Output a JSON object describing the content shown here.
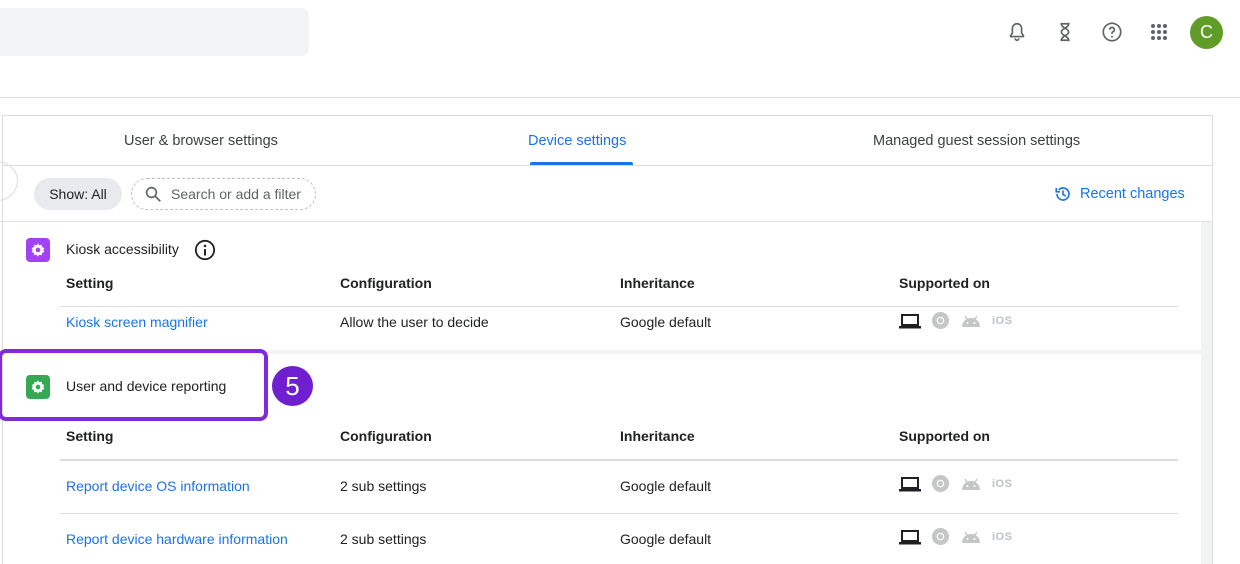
{
  "top_bar": {
    "icons": [
      "bell-icon",
      "hourglass-icon",
      "help-icon",
      "apps-grid-icon"
    ],
    "avatar_initial": "C",
    "avatar_color": "#5f9c28"
  },
  "tabs": [
    {
      "label": "User & browser settings",
      "active": false
    },
    {
      "label": "Device settings",
      "active": true
    },
    {
      "label": "Managed guest session settings",
      "active": false
    }
  ],
  "filter_bar": {
    "show_label": "Show: All",
    "search_placeholder": "Search or add a filter",
    "recent_changes_label": "Recent changes"
  },
  "columns": [
    "Setting",
    "Configuration",
    "Inheritance",
    "Supported on"
  ],
  "sections": [
    {
      "title": "Kiosk accessibility",
      "icon": "settings-gear-icon",
      "icon_color": "#a142f4",
      "has_info_icon": true,
      "rows": [
        {
          "setting": "Kiosk screen magnifier",
          "configuration": "Allow the user to decide",
          "inheritance": "Google default"
        }
      ]
    },
    {
      "title": "User and device reporting",
      "icon": "settings-gear-icon",
      "icon_color": "#34a853",
      "has_info_icon": false,
      "rows": [
        {
          "setting": "Report device OS information",
          "configuration": "2 sub settings",
          "inheritance": "Google default"
        },
        {
          "setting": "Report device hardware information",
          "configuration": "2 sub settings",
          "inheritance": "Google default"
        }
      ]
    }
  ],
  "supported_platforms": [
    "laptop-icon",
    "chrome-icon",
    "android-icon",
    "ios-icon"
  ],
  "ios_label": "iOS",
  "annotation": {
    "step_number": "5",
    "color": "#7e2bd8"
  },
  "colors": {
    "accent": "#1a73e8",
    "highlight": "#7e2bd8"
  }
}
